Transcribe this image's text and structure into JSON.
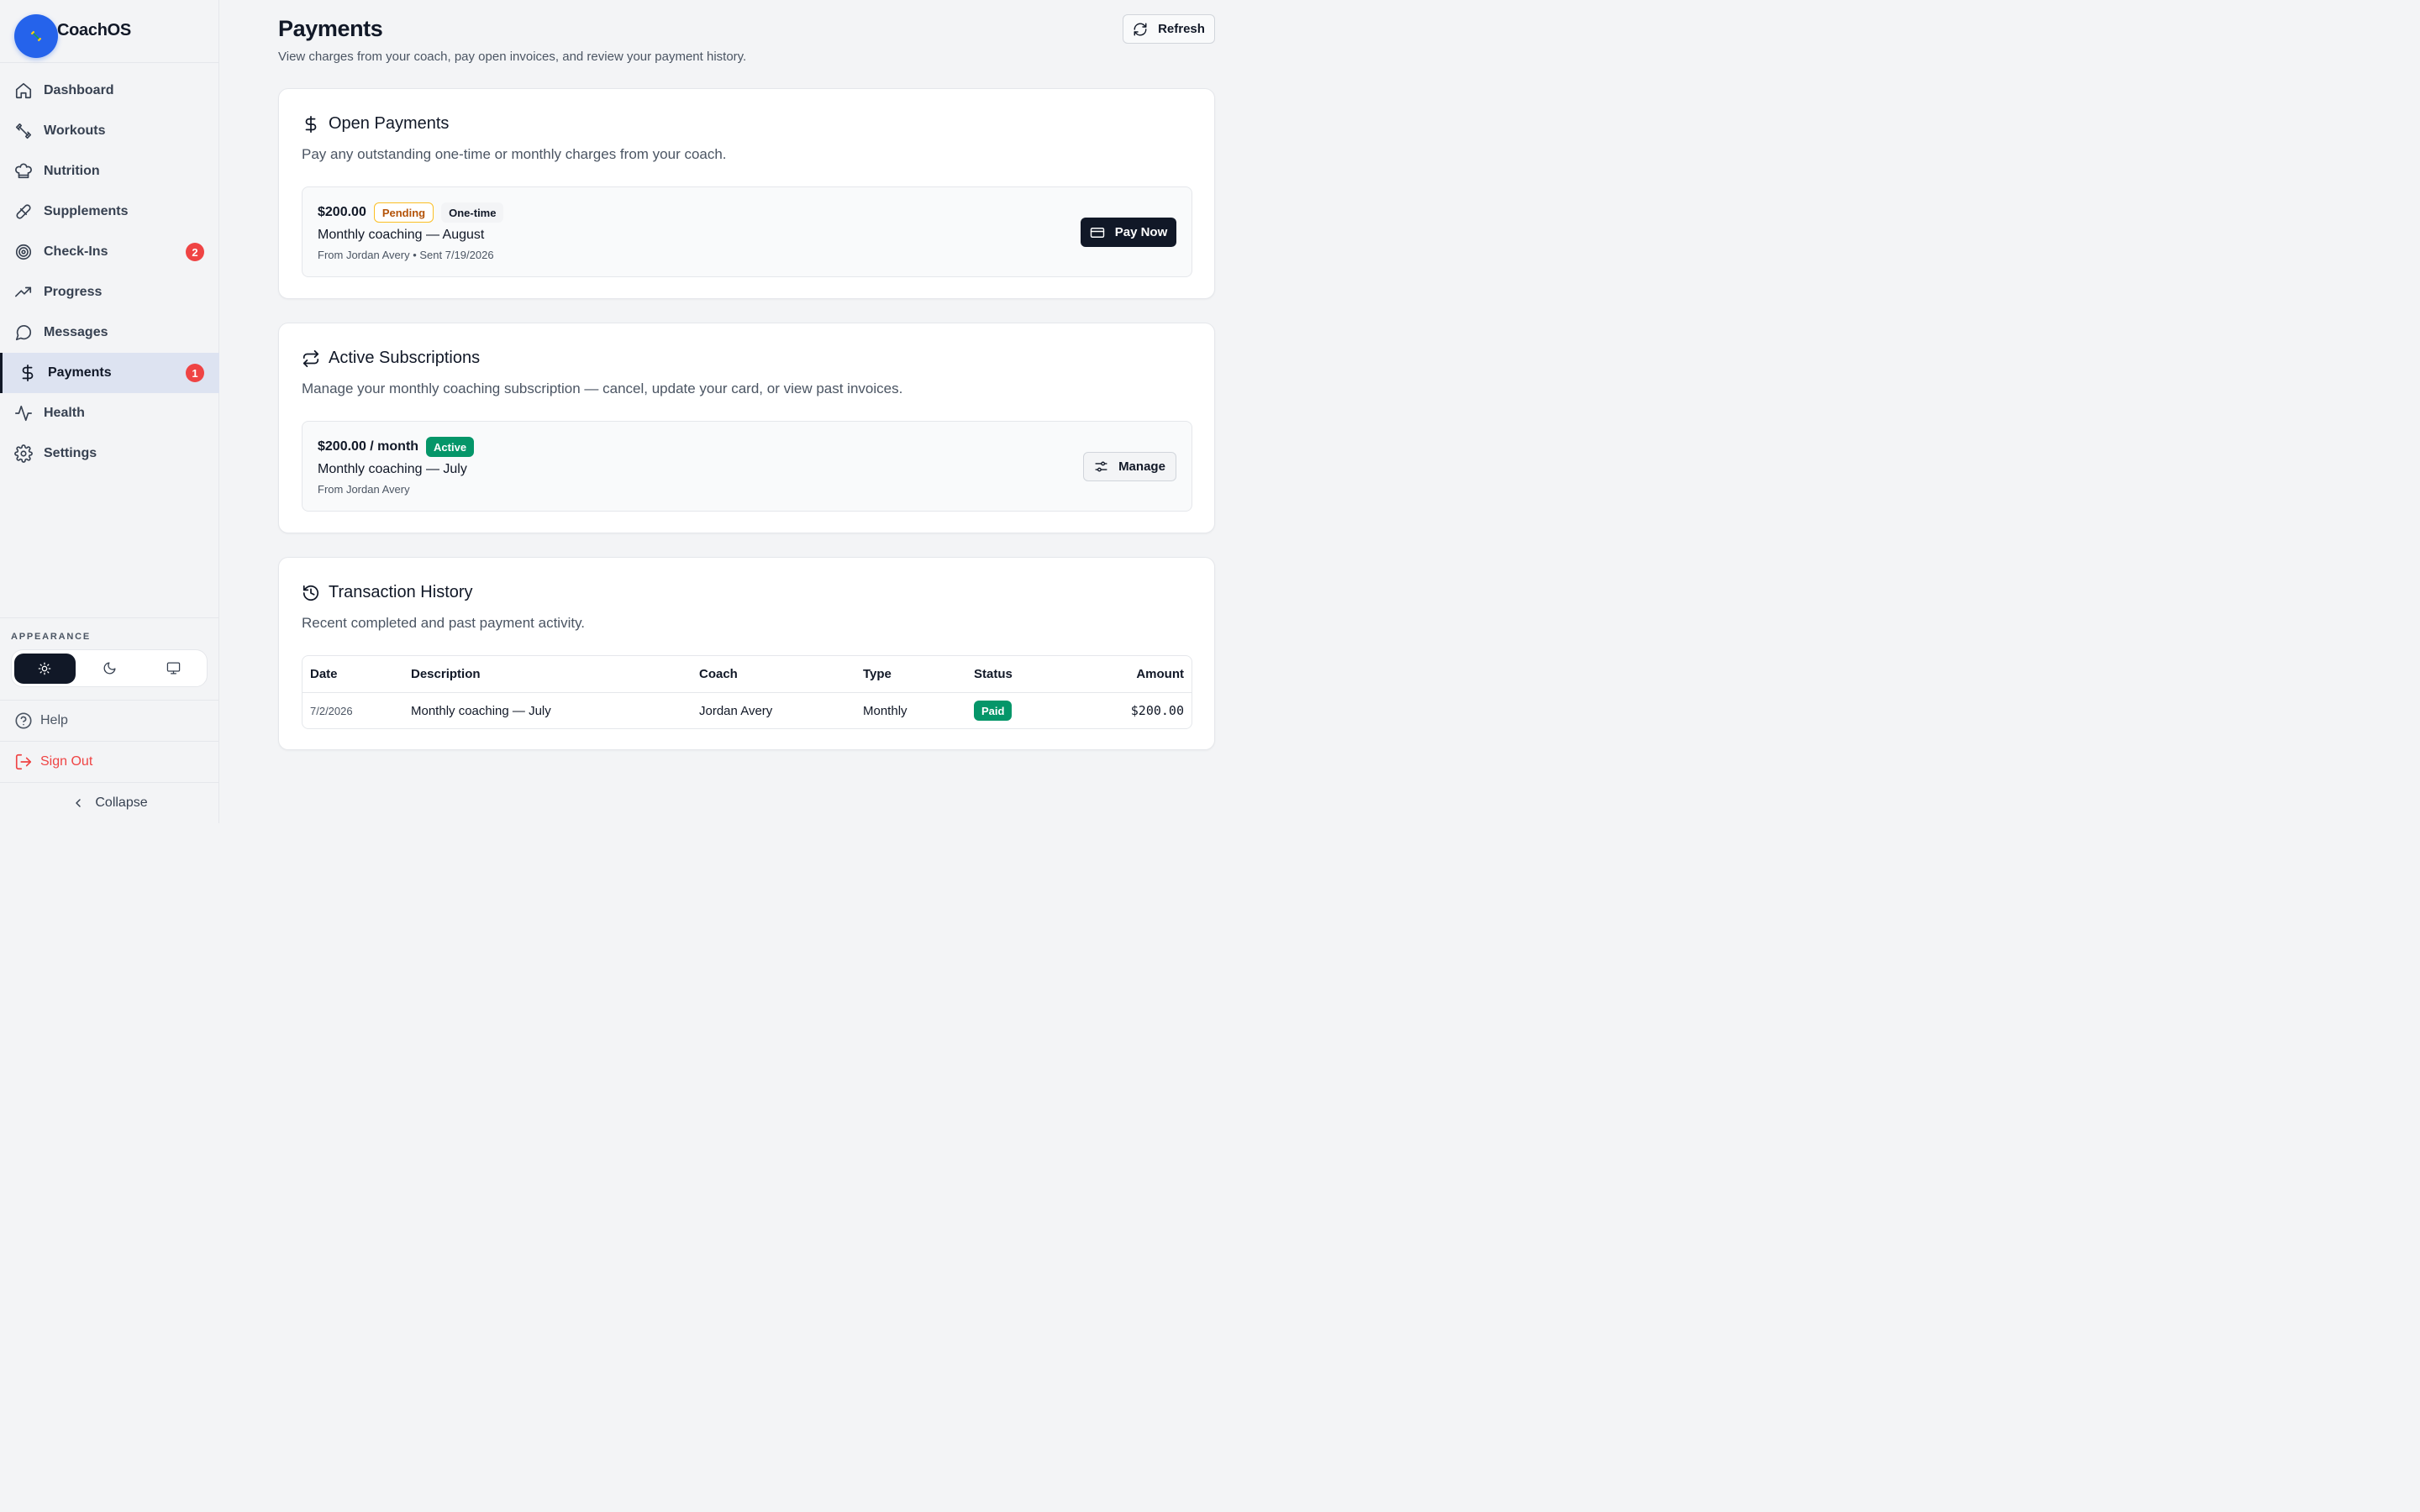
{
  "app": {
    "name": "CoachOS"
  },
  "sidebar": {
    "items": [
      {
        "label": "Dashboard",
        "icon": "home-icon"
      },
      {
        "label": "Workouts",
        "icon": "dumbbell-icon"
      },
      {
        "label": "Nutrition",
        "icon": "chef-hat-icon"
      },
      {
        "label": "Supplements",
        "icon": "pill-icon"
      },
      {
        "label": "Check-Ins",
        "icon": "target-icon",
        "badge": "2"
      },
      {
        "label": "Progress",
        "icon": "trending-up-icon"
      },
      {
        "label": "Messages",
        "icon": "message-circle-icon"
      },
      {
        "label": "Payments",
        "icon": "dollar-icon",
        "badge": "1",
        "active": true
      },
      {
        "label": "Health",
        "icon": "activity-icon"
      },
      {
        "label": "Settings",
        "icon": "gear-icon"
      }
    ],
    "appearance_title": "APPEARANCE",
    "theme_options": [
      "sun-icon",
      "moon-icon",
      "monitor-icon"
    ],
    "help_label": "Help",
    "signout_label": "Sign Out",
    "collapse_label": "Collapse"
  },
  "header": {
    "title": "Payments",
    "subtitle": "View charges from your coach, pay open invoices, and review your payment history.",
    "refresh_label": "Refresh"
  },
  "open_payments": {
    "title": "Open Payments",
    "description": "Pay any outstanding one-time or monthly charges from your coach.",
    "item": {
      "amount": "$200.00",
      "status": "Pending",
      "type": "One-time",
      "title": "Monthly coaching — August",
      "meta": "From Jordan Avery • Sent 7/19/2026",
      "button": "Pay Now"
    }
  },
  "subscriptions": {
    "title": "Active Subscriptions",
    "description": "Manage your monthly coaching subscription — cancel, update your card, or view past invoices.",
    "item": {
      "amount": "$200.00 / month",
      "status": "Active",
      "title": "Monthly coaching — July",
      "meta": "From Jordan Avery",
      "button": "Manage"
    }
  },
  "history": {
    "title": "Transaction History",
    "description": "Recent completed and past payment activity.",
    "columns": {
      "date": "Date",
      "description": "Description",
      "coach": "Coach",
      "type": "Type",
      "status": "Status",
      "amount": "Amount"
    },
    "rows": [
      {
        "date": "7/2/2026",
        "description": "Monthly coaching — July",
        "coach": "Jordan Avery",
        "type": "Monthly",
        "status": "Paid",
        "amount": "$200.00"
      }
    ]
  },
  "colors": {
    "accent": "#2563eb",
    "badge": "#ef4444",
    "success": "#059669",
    "pending": "#b45309",
    "dark": "#111827"
  }
}
